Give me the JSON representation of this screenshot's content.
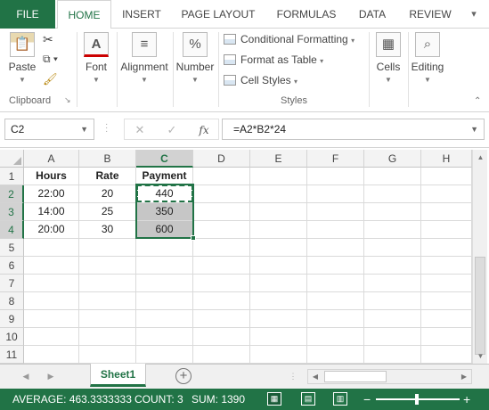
{
  "tabs": [
    "FILE",
    "HOME",
    "INSERT",
    "PAGE LAYOUT",
    "FORMULAS",
    "DATA",
    "REVIEW"
  ],
  "window_controls": {
    "scroll_right": "▾"
  },
  "ribbon": {
    "clipboard": {
      "paste_label": "Paste",
      "group_label": "Clipboard"
    },
    "font": {
      "label": "Font"
    },
    "alignment": {
      "label": "Alignment"
    },
    "number": {
      "label": "Number"
    },
    "styles": {
      "conditional_formatting": "Conditional Formatting",
      "format_as_table": "Format as Table",
      "cell_styles": "Cell Styles",
      "group_label": "Styles"
    },
    "cells": {
      "label": "Cells"
    },
    "editing": {
      "label": "Editing"
    }
  },
  "formula_bar": {
    "name_box": "C2",
    "formula": "=A2*B2*24",
    "fx_label": "fx"
  },
  "columns": [
    "A",
    "B",
    "C",
    "D",
    "E",
    "F",
    "G",
    "H"
  ],
  "selected_column": "C",
  "rows": [
    "1",
    "2",
    "3",
    "4",
    "5",
    "6",
    "7",
    "8",
    "9",
    "10",
    "11"
  ],
  "headers": [
    "Hours",
    "Rate",
    "Payment"
  ],
  "data": [
    [
      "22:00",
      "20",
      "440"
    ],
    [
      "14:00",
      "25",
      "350"
    ],
    [
      "20:00",
      "30",
      "600"
    ]
  ],
  "sheet": {
    "name": "Sheet1",
    "add_icon": "⊕"
  },
  "status": {
    "average": "AVERAGE: 463.3333333",
    "count": "COUNT: 3",
    "sum": "SUM: 1390"
  },
  "colors": {
    "accent": "#217346",
    "selection_shade": "#c6c6c6"
  }
}
